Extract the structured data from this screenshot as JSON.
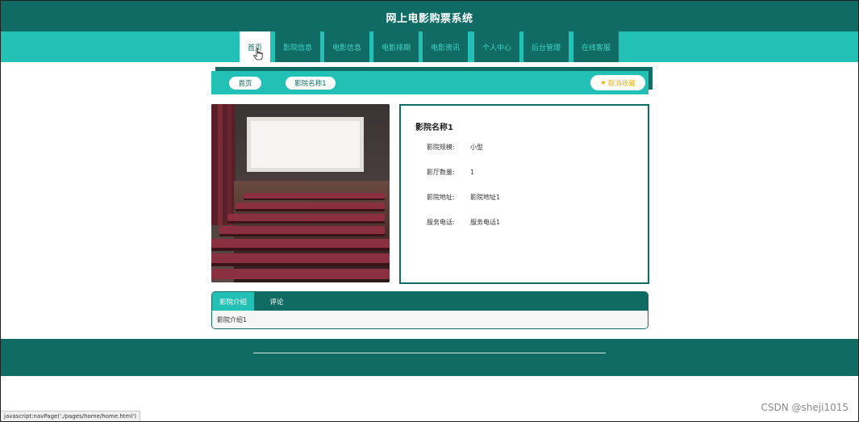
{
  "header": {
    "title": "网上电影购票系统"
  },
  "nav": {
    "items": [
      {
        "label": "首页",
        "active": true
      },
      {
        "label": "影院信息"
      },
      {
        "label": "电影信息"
      },
      {
        "label": "电影排期"
      },
      {
        "label": "电影资讯"
      },
      {
        "label": "个人中心"
      },
      {
        "label": "后台管理"
      },
      {
        "label": "在线客服"
      }
    ]
  },
  "breadcrumb": {
    "home": "首页",
    "current": "影院名称1"
  },
  "favorite_label": "取消收藏",
  "cinema": {
    "name": "影院名称1",
    "fields": [
      {
        "label": "影院规模:",
        "value": "小型"
      },
      {
        "label": "影厅数量:",
        "value": "1"
      },
      {
        "label": "影院地址:",
        "value": "影院地址1"
      },
      {
        "label": "服务电话:",
        "value": "服务电话1"
      }
    ]
  },
  "tabs": {
    "items": [
      "影院介绍",
      "评论"
    ],
    "content": "影院介绍1"
  },
  "statusbar": "javascript:navPage('./pages/home/home.html')",
  "watermark": "CSDN @sheji1015",
  "colors": {
    "dark_teal": "#0f6b63",
    "teal": "#23c0b6",
    "gold": "#e6b400"
  }
}
